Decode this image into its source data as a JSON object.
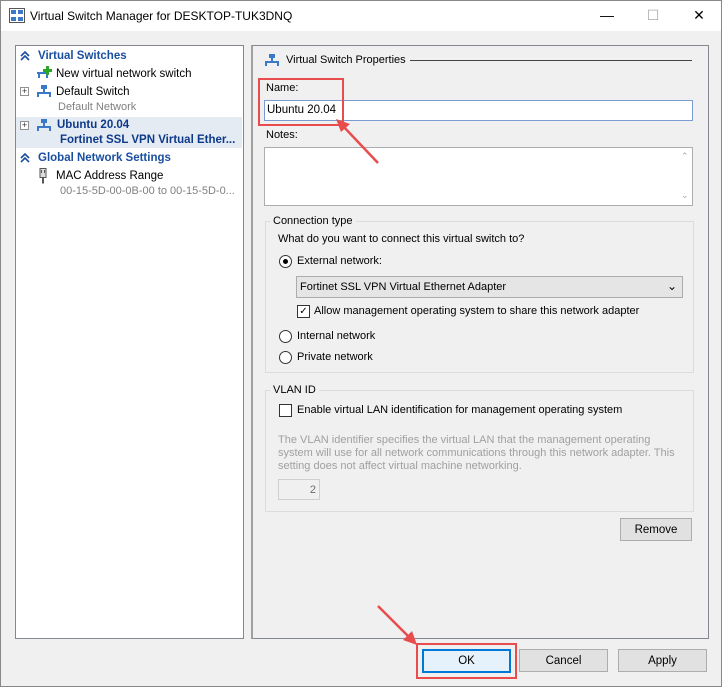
{
  "window": {
    "title": "Virtual Switch Manager for DESKTOP-TUK3DNQ",
    "minimize": "—",
    "maximize": "☐",
    "close": "✕"
  },
  "sidebar": {
    "virtual_switches_header": "Virtual Switches",
    "new_switch": "New virtual network switch",
    "default_switch": {
      "name": "Default Switch",
      "sub": "Default Network"
    },
    "ubuntu_switch": {
      "name": "Ubuntu 20.04",
      "sub": "Fortinet SSL VPN Virtual Ether..."
    },
    "global_header": "Global Network Settings",
    "mac": {
      "name": "MAC Address Range",
      "sub": "00-15-5D-00-0B-00 to 00-15-5D-0..."
    }
  },
  "properties": {
    "header": "Virtual Switch Properties",
    "name_label": "Name:",
    "name_value": "Ubuntu 20.04",
    "notes_label": "Notes:",
    "notes_value": "",
    "connection_type": {
      "title": "Connection type",
      "question": "What do you want to connect this virtual switch to?",
      "external": "External network:",
      "adapter": "Fortinet SSL VPN Virtual Ethernet Adapter",
      "allow_mgmt": "Allow management operating system to share this network adapter",
      "internal": "Internal network",
      "private": "Private network",
      "selected": "External network:",
      "allow_mgmt_checked": true
    },
    "vlan": {
      "title": "VLAN ID",
      "enable": "Enable virtual LAN identification for management operating system",
      "enabled": false,
      "description": "The VLAN identifier specifies the virtual LAN that the management operating system will use for all network communications through this network adapter. This setting does not affect virtual machine networking.",
      "value": "2"
    },
    "remove_label": "Remove"
  },
  "footer": {
    "ok_label": "OK",
    "cancel_label": "Cancel",
    "apply_label": "Apply"
  },
  "colors": {
    "highlight": "#e84c4c",
    "section_blue": "#1a4fa0",
    "selection": "#e5ebf3"
  }
}
